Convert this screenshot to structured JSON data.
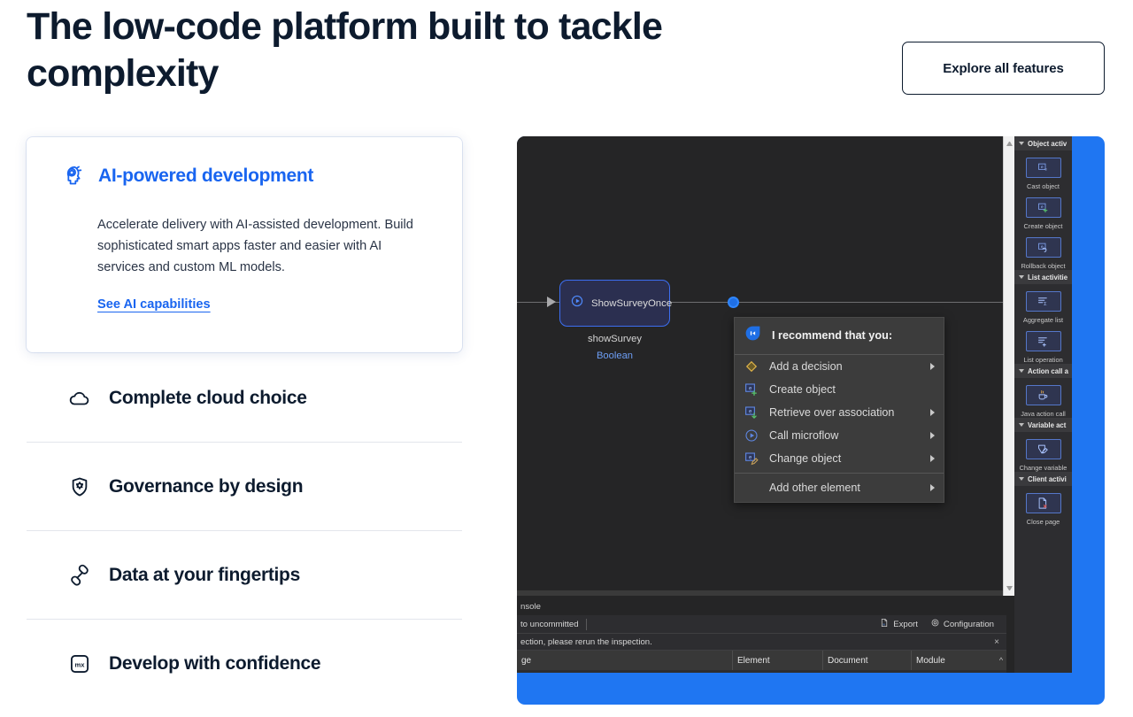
{
  "hero": {
    "title": "The low-code platform built to tackle complexity",
    "cta_label": "Explore all features"
  },
  "feature_card": {
    "icon": "ai-head-icon",
    "title": "AI-powered development",
    "body": "Accelerate delivery with AI-assisted development. Build sophisticated smart apps faster and easier with AI services and custom ML models.",
    "link_label": "See AI capabilities",
    "accent_color": "#1965f0"
  },
  "accordion": {
    "items": [
      {
        "icon": "cloud-icon",
        "label": "Complete cloud choice"
      },
      {
        "icon": "shield-gear-icon",
        "label": "Governance by design"
      },
      {
        "icon": "link-chain-icon",
        "label": "Data at your fingertips"
      },
      {
        "icon": "mx-badge-icon",
        "label": "Develop with confidence"
      }
    ]
  },
  "ide": {
    "accent_color": "#1f76f2",
    "canvas": {
      "node": {
        "icon": "play-circle-icon",
        "label": "ShowSurveyOnce",
        "caption_name": "showSurvey",
        "caption_type": "Boolean"
      }
    },
    "context_menu": {
      "header": "I recommend that you:",
      "header_icon": "mendix-assist-icon",
      "items": [
        {
          "icon": "decision-diamond-icon",
          "label": "Add a decision",
          "submenu": true
        },
        {
          "icon": "create-object-icon",
          "label": "Create object",
          "submenu": false
        },
        {
          "icon": "retrieve-object-icon",
          "label": "Retrieve over association",
          "submenu": true
        },
        {
          "icon": "call-microflow-icon",
          "label": "Call microflow",
          "submenu": true
        },
        {
          "icon": "change-object-icon",
          "label": "Change object",
          "submenu": true
        }
      ],
      "footer": {
        "label": "Add other element",
        "submenu": true
      }
    },
    "toolbox": {
      "groups": [
        {
          "category": "Object activ",
          "items": [
            {
              "icon": "cast-object-icon",
              "label": "Cast object"
            },
            {
              "icon": "create-object-icon",
              "label": "Create object"
            },
            {
              "icon": "rollback-object-icon",
              "label": "Rollback object"
            }
          ]
        },
        {
          "category": "List activitie",
          "items": [
            {
              "icon": "aggregate-list-icon",
              "label": "Aggregate list"
            },
            {
              "icon": "list-operation-icon",
              "label": "List operation"
            }
          ]
        },
        {
          "category": "Action call a",
          "items": [
            {
              "icon": "java-action-icon",
              "label": "Java action call"
            }
          ]
        },
        {
          "category": "Variable act",
          "items": [
            {
              "icon": "change-variable-icon",
              "label": "Change variable"
            }
          ]
        },
        {
          "category": "Client activi",
          "items": [
            {
              "icon": "close-page-icon",
              "label": "Close page"
            }
          ]
        }
      ]
    },
    "console": {
      "tab_label": "nsole",
      "filter_label": "to uncommitted",
      "export_label": "Export",
      "configuration_label": "Configuration",
      "notice": "ection, please rerun the inspection.",
      "notice_close": "×",
      "columns": [
        "ge",
        "Element",
        "Document",
        "Module"
      ]
    }
  }
}
